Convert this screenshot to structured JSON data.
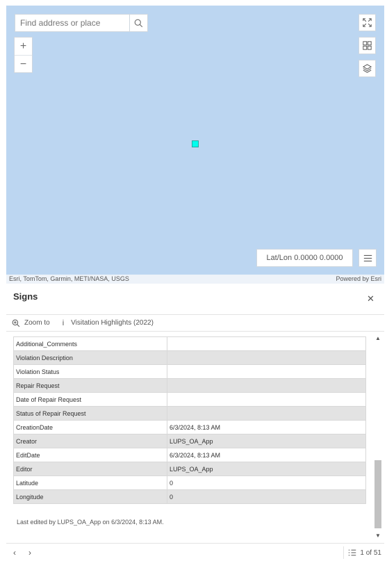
{
  "map": {
    "search": {
      "placeholder": "Find address or place"
    },
    "zoom": {
      "in_label": "+",
      "out_label": "−"
    },
    "latlon": "Lat/Lon 0.0000 0.0000",
    "attribution": {
      "left": "Esri, TomTom, Garmin, METI/NASA, USGS",
      "right": "Powered by Esri"
    }
  },
  "panel": {
    "title": "Signs",
    "actions": {
      "zoom_to": "Zoom to",
      "visitation": "Visitation Highlights (2022)"
    },
    "rows": [
      {
        "key": "Additional_Comments",
        "value": ""
      },
      {
        "key": "Violation Description",
        "value": ""
      },
      {
        "key": "Violation Status",
        "value": ""
      },
      {
        "key": "Repair Request",
        "value": ""
      },
      {
        "key": "Date of Repair Request",
        "value": ""
      },
      {
        "key": "Status of Repair Request",
        "value": ""
      },
      {
        "key": "CreationDate",
        "value": "6/3/2024, 8:13 AM"
      },
      {
        "key": "Creator",
        "value": "LUPS_OA_App"
      },
      {
        "key": "EditDate",
        "value": "6/3/2024, 8:13 AM"
      },
      {
        "key": "Editor",
        "value": "LUPS_OA_App"
      },
      {
        "key": "Latitude",
        "value": "0"
      },
      {
        "key": "Longitude",
        "value": "0"
      }
    ],
    "last_edited": "Last edited by LUPS_OA_App on 6/3/2024, 8:13 AM.",
    "pager": "1 of 51"
  },
  "colors": {
    "map_bg": "#bcd6f1",
    "marker": "#00ffee"
  }
}
